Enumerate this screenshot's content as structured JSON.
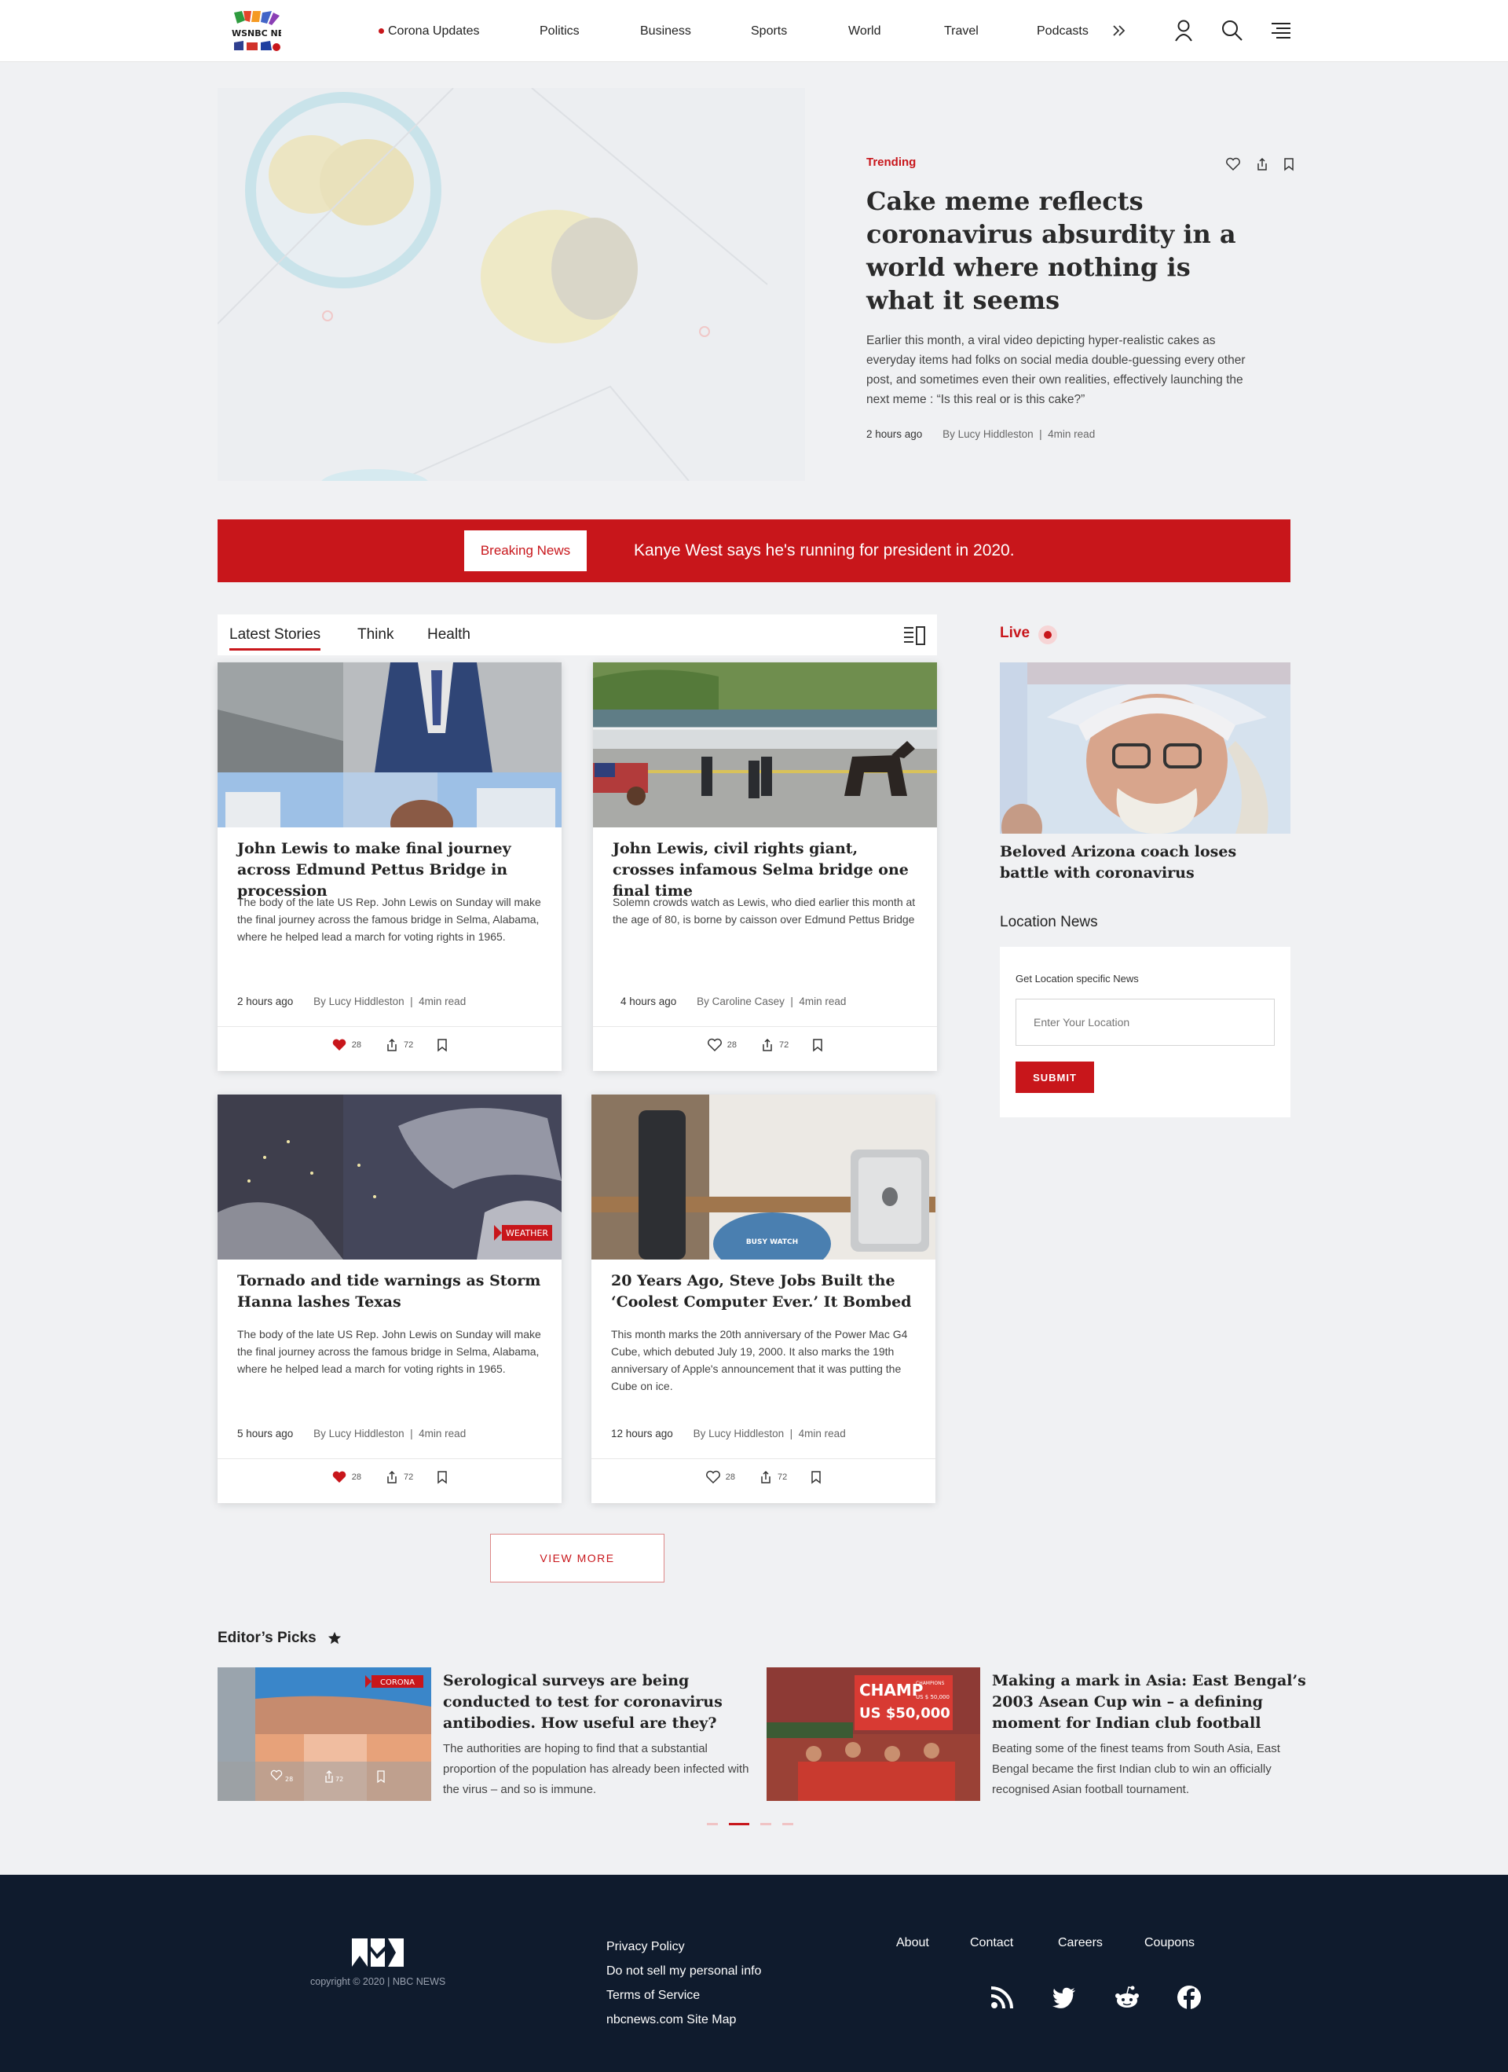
{
  "brand": {
    "logo_text": "WSNBC NE"
  },
  "nav": {
    "items": [
      "Corona Updates",
      "Politics",
      "Business",
      "Sports",
      "World",
      "Travel",
      "Podcasts"
    ],
    "more_icon": "double-chevron-right-icon",
    "icons": [
      "user-icon",
      "search-icon",
      "menu-icon"
    ]
  },
  "hero": {
    "tag": "Trending",
    "title": "Cake meme reflects coronavirus absurdity in a world where nothing is what it seems",
    "description": "Earlier this month, a viral video depicting hyper-realistic cakes as everyday items had folks on social media double-guessing every other post, and sometimes even their own realities, effectively launching the next meme : “Is this real or is this cake?”",
    "time": "2 hours ago",
    "author": "By Lucy Hiddleston",
    "read": "4min read"
  },
  "breaking": {
    "label": "Breaking News",
    "text": "Kanye West says he's running for president in 2020."
  },
  "tabs": [
    "Latest Stories",
    "Think",
    "Health"
  ],
  "cards": [
    {
      "title": "John Lewis to make final journey across Edmund Pettus Bridge in procession",
      "desc": "The body of the late US Rep. John Lewis on Sunday will make the final journey across the famous bridge in Selma, Alabama, where he helped lead a march for voting rights in 1965.",
      "time": "2 hours ago",
      "author": "By Lucy Hiddleston",
      "read": "4min read",
      "likes": "28",
      "shares": "72",
      "liked": true
    },
    {
      "title": "John Lewis, civil rights giant, crosses infamous Selma bridge one final time",
      "desc": "Solemn crowds watch as Lewis, who died earlier this month at the age of 80, is borne by caisson over Edmund Pettus Bridge",
      "time": "4 hours ago",
      "author": "By Caroline Casey",
      "read": "4min read",
      "likes": "28",
      "shares": "72",
      "liked": false
    },
    {
      "title": "Tornado and tide warnings as Storm Hanna lashes Texas",
      "desc": "The body of the late US Rep. John Lewis on Sunday will make the final journey across the famous bridge in Selma, Alabama, where he helped lead a march for voting rights in 1965.",
      "time": "5 hours ago",
      "author": "By Lucy Hiddleston",
      "read": "4min read",
      "likes": "28",
      "shares": "72",
      "liked": true,
      "badge": "WEATHER"
    },
    {
      "title": "20 Years Ago, Steve Jobs Built the ‘Coolest Computer Ever.’ It Bombed",
      "desc": "This month marks the 20th anniversary of the Power Mac G4 Cube, which debuted July 19, 2000. It also marks the 19th anniversary of Apple's announcement that it was putting the Cube on ice.",
      "time": "12 hours ago",
      "author": "By Lucy Hiddleston",
      "read": "4min read",
      "likes": "28",
      "shares": "72",
      "liked": false
    }
  ],
  "live": {
    "label": "Live",
    "title": "Beloved Arizona coach loses battle with coronavirus"
  },
  "location": {
    "heading": "Location News",
    "label": "Get Location specific News",
    "placeholder": "Enter Your Location",
    "submit": "SUBMIT"
  },
  "view_more": "VIEW MORE",
  "editors": {
    "heading": "Editor’s Picks",
    "picks": [
      {
        "title": "Serological surveys are being conducted to test for coronavirus antibodies. How useful are they?",
        "desc": "The authorities are hoping to find that a substantial proportion of the population has already been infected with the virus – and so is immune.",
        "badge": "CORONA",
        "likes": "28",
        "shares": "72"
      },
      {
        "title": "Making a mark in Asia: East Bengal’s 2003 Asean Cup win – a defining moment for Indian club football",
        "desc": "Beating some of the finest teams from South Asia, East Bengal became the first Indian club to win an officially recognised Asian football tournament.",
        "banner_1": "CHAMP",
        "banner_2": "US $50,000",
        "banner_3": "US $ 50,000",
        "banner_4": "CHAMPIONS"
      }
    ],
    "pagination": {
      "pages": 4,
      "active": 2
    }
  },
  "footer": {
    "copyright": "copyright ©  2020 | NBC NEWS",
    "links": [
      "Privacy Policy",
      "Do not sell my personal info",
      "Terms of Service",
      "nbcnews.com Site Map"
    ],
    "nav": [
      "About",
      "Contact",
      "Careers",
      "Coupons"
    ],
    "social": [
      "rss-icon",
      "twitter-icon",
      "reddit-icon",
      "facebook-icon"
    ]
  },
  "colors": {
    "accent": "#c8161b",
    "footer_bg": "#0f1b2d",
    "page_bg": "#f0f1f3"
  }
}
